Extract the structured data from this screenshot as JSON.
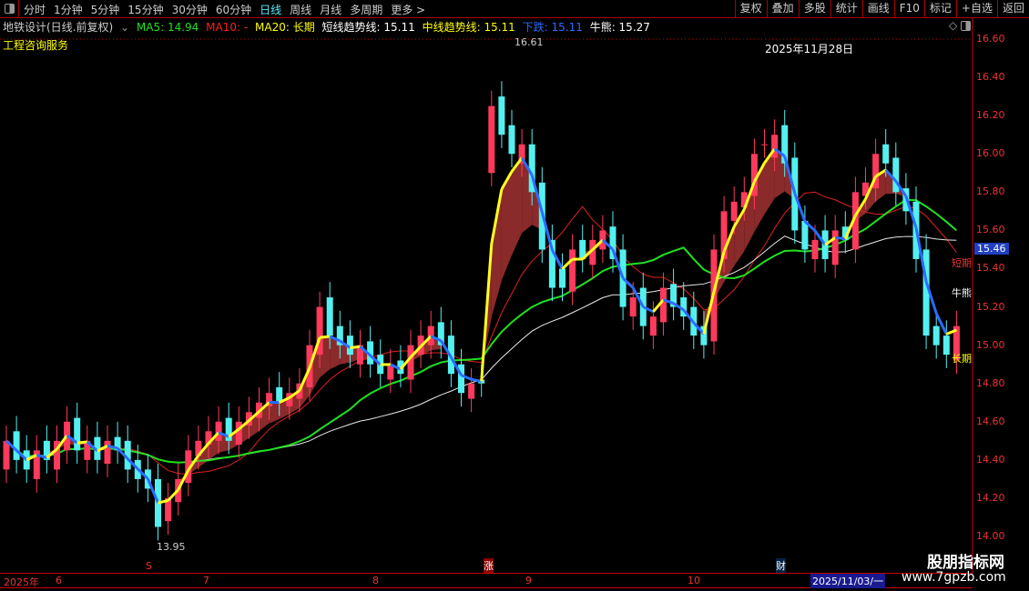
{
  "toolbar": {
    "periods": [
      "分时",
      "1分钟",
      "5分钟",
      "15分钟",
      "30分钟",
      "60分钟",
      "日线",
      "周线",
      "月线",
      "多周期",
      "更多 >"
    ],
    "active": "日线",
    "tools": [
      "复权",
      "叠加",
      "多股",
      "统计",
      "画线",
      "F10",
      "标记",
      "+自选",
      "返回"
    ]
  },
  "legend": {
    "title": "地铁设计(日线.前复权)",
    "ma5": "MA5: 14.94",
    "ma10": "MA10: -",
    "ma20": "MA20: 长期",
    "short_trend": "短线趋势线: 15.11",
    "mid_trend": "中线趋势线: 15.11",
    "down": "下跌: 15.11",
    "bull_bear": "牛熊: 15.27"
  },
  "subtitle": "工程咨询服务",
  "date_label": "2025年11月28日",
  "annotations": {
    "high": "16.61",
    "low": "13.95",
    "short": "短期",
    "bull_bear": "牛熊",
    "long": "长期"
  },
  "current_price": "15.46",
  "markers": {
    "s": "S",
    "zhang": "涨",
    "cai": "财"
  },
  "xaxis": {
    "year": "2025年",
    "months": [
      "6",
      "7",
      "8",
      "9",
      "10"
    ],
    "current_date": "2025/11/03/一"
  },
  "watermark": {
    "name": "股朋指标网",
    "url": "www.7gpzb.com"
  },
  "colors": {
    "up": "#ff3a5c",
    "down": "#54f0f0",
    "ma_short": "#e02020",
    "ma_bullbear": "#e8e8e8",
    "ma_long": "#20e020",
    "trend_up": "#ffff20",
    "trend_down": "#2a6cff",
    "fill": "#8b2a2a"
  },
  "chart_data": {
    "type": "candlestick",
    "ylim": [
      14.0,
      16.6
    ],
    "yticks": [
      "16.60",
      "16.40",
      "16.20",
      "16.00",
      "15.80",
      "15.60",
      "15.40",
      "15.20",
      "15.00",
      "14.80",
      "14.60",
      "14.40",
      "14.20",
      "14.00"
    ],
    "close": [
      14.5,
      14.4,
      14.35,
      14.45,
      14.4,
      14.5,
      14.6,
      14.45,
      14.5,
      14.4,
      14.5,
      14.45,
      14.35,
      14.3,
      14.25,
      14.05,
      14.2,
      14.3,
      14.45,
      14.5,
      14.55,
      14.6,
      14.5,
      14.6,
      14.65,
      14.7,
      14.75,
      14.7,
      14.75,
      14.8,
      15.0,
      15.2,
      15.05,
      15.0,
      14.95,
      15.0,
      14.9,
      14.85,
      14.9,
      14.85,
      15.0,
      15.05,
      15.1,
      15.0,
      14.85,
      14.75,
      14.8,
      14.8,
      16.25,
      16.1,
      16.0,
      16.05,
      15.8,
      15.5,
      15.3,
      15.3,
      15.5,
      15.45,
      15.55,
      15.6,
      15.45,
      15.2,
      15.25,
      15.1,
      15.15,
      15.3,
      15.2,
      15.15,
      15.05,
      15.0,
      15.5,
      15.7,
      15.75,
      15.8,
      16.0,
      16.05,
      16.1,
      15.95,
      15.6,
      15.5,
      15.55,
      15.45,
      15.6,
      15.55,
      15.8,
      15.85,
      16.0,
      15.95,
      15.8,
      15.7,
      15.45,
      15.05,
      15.0,
      14.95,
      15.1
    ],
    "open": [
      14.35,
      14.55,
      14.45,
      14.3,
      14.5,
      14.35,
      14.45,
      14.62,
      14.4,
      14.52,
      14.38,
      14.52,
      14.5,
      14.4,
      14.35,
      14.3,
      14.08,
      14.18,
      14.28,
      14.42,
      14.48,
      14.5,
      14.62,
      14.48,
      14.58,
      14.62,
      14.68,
      14.78,
      14.68,
      14.72,
      14.78,
      14.95,
      15.25,
      15.1,
      15.05,
      14.9,
      15.02,
      14.95,
      14.82,
      14.92,
      14.82,
      14.95,
      15.0,
      15.12,
      15.05,
      14.9,
      14.72,
      14.82,
      15.9,
      16.3,
      16.15,
      15.95,
      16.05,
      15.85,
      15.55,
      15.4,
      15.28,
      15.55,
      15.42,
      15.5,
      15.62,
      15.5,
      15.15,
      15.3,
      15.05,
      15.12,
      15.32,
      15.25,
      15.2,
      15.1,
      15.02,
      15.45,
      15.65,
      15.72,
      15.78,
      16.05,
      15.98,
      16.15,
      15.98,
      15.65,
      15.45,
      15.6,
      15.42,
      15.62,
      15.5,
      15.78,
      15.82,
      16.05,
      15.98,
      15.82,
      15.75,
      15.5,
      15.1,
      15.05,
      14.92
    ]
  }
}
